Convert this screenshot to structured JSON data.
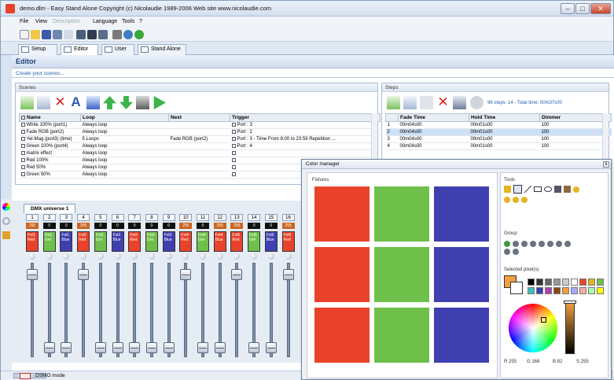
{
  "window": {
    "title": "demo.dlm - Easy Stand Alone   Copyright (c) Nicolaudie 1989-2006   Web site www.nicolaudie.com"
  },
  "menu": [
    "File",
    "View",
    "Description",
    "Language",
    "Tools",
    "?"
  ],
  "tabs": [
    "Setup",
    "Editor",
    "User",
    "Stand Alone"
  ],
  "editor": {
    "title": "Editor",
    "hint": "Create your scenes..."
  },
  "scenes": {
    "title": "Scenes",
    "columns": [
      "Name",
      "Loop",
      "Next",
      "Trigger"
    ],
    "rows": [
      {
        "name": "White 100% (port1)",
        "loop": "Always loop",
        "next": "",
        "trigger": "Port : 3"
      },
      {
        "name": "Fade RGB (port2)",
        "loop": "Always loop",
        "next": "",
        "trigger": "Port : 2"
      },
      {
        "name": "Yel-Mag (port3) (time)",
        "loop": "5 Loops",
        "next": "Fade RGB (port2)",
        "trigger": "Port : 3 - Time From 8:00 to 23:59 Repetition ..."
      },
      {
        "name": "Green 100% (port4)",
        "loop": "Always loop",
        "next": "",
        "trigger": "Port : 4"
      },
      {
        "name": "matrix effect",
        "loop": "Always loop",
        "next": "",
        "trigger": ""
      },
      {
        "name": "Red 100%",
        "loop": "Always loop",
        "next": "",
        "trigger": ""
      },
      {
        "name": "Red 50%",
        "loop": "Always loop",
        "next": "",
        "trigger": ""
      },
      {
        "name": "Green 50%",
        "loop": "Always loop",
        "next": "",
        "trigger": ""
      }
    ]
  },
  "steps": {
    "title": "Steps",
    "summary": "96 steps: 14 - Total time: 00m37s00",
    "columns": [
      "",
      "Fade Time",
      "Hold Time",
      "Dimmer"
    ],
    "rows": [
      {
        "n": "1",
        "fade": "00m04s00",
        "hold": "00m01s00",
        "dim": "100"
      },
      {
        "n": "2",
        "fade": "00m04s00",
        "hold": "00m01s00",
        "dim": "100"
      },
      {
        "n": "3",
        "fade": "00m04s00",
        "hold": "00m01s00",
        "dim": "100"
      },
      {
        "n": "4",
        "fade": "00m04s00",
        "hold": "00m01s00",
        "dim": "100"
      }
    ]
  },
  "dmx": {
    "tab": "DMX universe 1",
    "channels": [
      {
        "n": "1",
        "v": "255",
        "c": "#e8432a",
        "l": "Fxt1 Red",
        "pos": 0.92
      },
      {
        "n": "2",
        "v": "0",
        "c": "#6fc04a",
        "l": "Fxt1 Gre",
        "pos": 0.05
      },
      {
        "n": "3",
        "v": "0",
        "c": "#3f3fb0",
        "l": "Fxt1 Blue",
        "pos": 0.05
      },
      {
        "n": "4",
        "v": "255",
        "c": "#e8432a",
        "l": "Fxt2 Red",
        "pos": 0.92
      },
      {
        "n": "5",
        "v": "0",
        "c": "#6fc04a",
        "l": "Fxt2 Gre",
        "pos": 0.05
      },
      {
        "n": "6",
        "v": "0",
        "c": "#3f3fb0",
        "l": "Fxt2 Blue",
        "pos": 0.05
      },
      {
        "n": "7",
        "v": "0",
        "c": "#e8432a",
        "l": "Fxt3 Red",
        "pos": 0.05
      },
      {
        "n": "8",
        "v": "0",
        "c": "#6fc04a",
        "l": "Fxt3 Gre",
        "pos": 0.05
      },
      {
        "n": "9",
        "v": "0",
        "c": "#3f3fb0",
        "l": "Fxt3 Blue",
        "pos": 0.05
      },
      {
        "n": "10",
        "v": "255",
        "c": "#e8432a",
        "l": "Fxt4 Red",
        "pos": 0.92
      },
      {
        "n": "11",
        "v": "0",
        "c": "#6fc04a",
        "l": "Fxt4 Gre",
        "pos": 0.05
      },
      {
        "n": "12",
        "v": "255",
        "c": "#e8432a",
        "l": "Fxt4 Blue",
        "pos": 0.05
      },
      {
        "n": "13",
        "v": "255",
        "c": "#e8432a",
        "l": "Fxt5 Red",
        "pos": 0.92
      },
      {
        "n": "14",
        "v": "0",
        "c": "#6fc04a",
        "l": "Fxt5 Gre",
        "pos": 0.05
      },
      {
        "n": "15",
        "v": "0",
        "c": "#3f3fb0",
        "l": "Fxt5 Blue",
        "pos": 0.05
      },
      {
        "n": "16",
        "v": "255",
        "c": "#e8432a",
        "l": "Fxt6 Red",
        "pos": 0.92
      }
    ]
  },
  "colorManager": {
    "title": "Color manager",
    "fixtures_label": "Fixtures",
    "tools_label": "Tools",
    "group_label": "Group",
    "selected_label": "Selected pixel(s)",
    "fixtures": [
      [
        "#e8432a",
        "#6fc04a",
        "#3f3fb0"
      ],
      [
        "#e8432a",
        "#6fc04a",
        "#3f3fb0"
      ],
      [
        "#e8432a",
        "#6fc04a",
        "#3f3fb0"
      ]
    ],
    "rgb": {
      "r": "R 255",
      "g": "G 168",
      "b": "B 82",
      "s": "S 255"
    }
  },
  "status": {
    "mode": "DSMO mode"
  }
}
